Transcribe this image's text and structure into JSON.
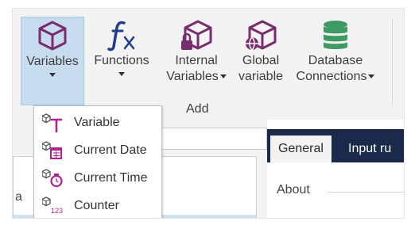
{
  "ribbon": {
    "variables": {
      "label": "Variables"
    },
    "functions": {
      "label": "Functions"
    },
    "internal": {
      "line1": "Internal",
      "line2": "Variables"
    },
    "global": {
      "line1": "Global",
      "line2": "variable"
    },
    "database": {
      "line1": "Database",
      "line2": "Connections"
    },
    "group_label": "Add"
  },
  "menu": {
    "items": [
      {
        "label": "Variable",
        "icon": "cube-text-T-icon"
      },
      {
        "label": "Current Date",
        "icon": "cube-calendar-icon"
      },
      {
        "label": "Current Time",
        "icon": "cube-clock-icon"
      },
      {
        "label": "Counter",
        "icon": "cube-counter-icon"
      }
    ],
    "counter_glyph": "123"
  },
  "left_panel": {
    "partial_text": "a"
  },
  "right_panel": {
    "tabs": [
      {
        "label": "General"
      },
      {
        "label": "Input ru"
      }
    ],
    "section": "About"
  },
  "colors": {
    "accent_purple": "#7a2d6e",
    "magenta": "#b0228f",
    "function_blue": "#1f3d8a",
    "database_green": "#3d9a63",
    "tab_dark": "#1b2a4a",
    "selection": "#c8dcf0"
  }
}
